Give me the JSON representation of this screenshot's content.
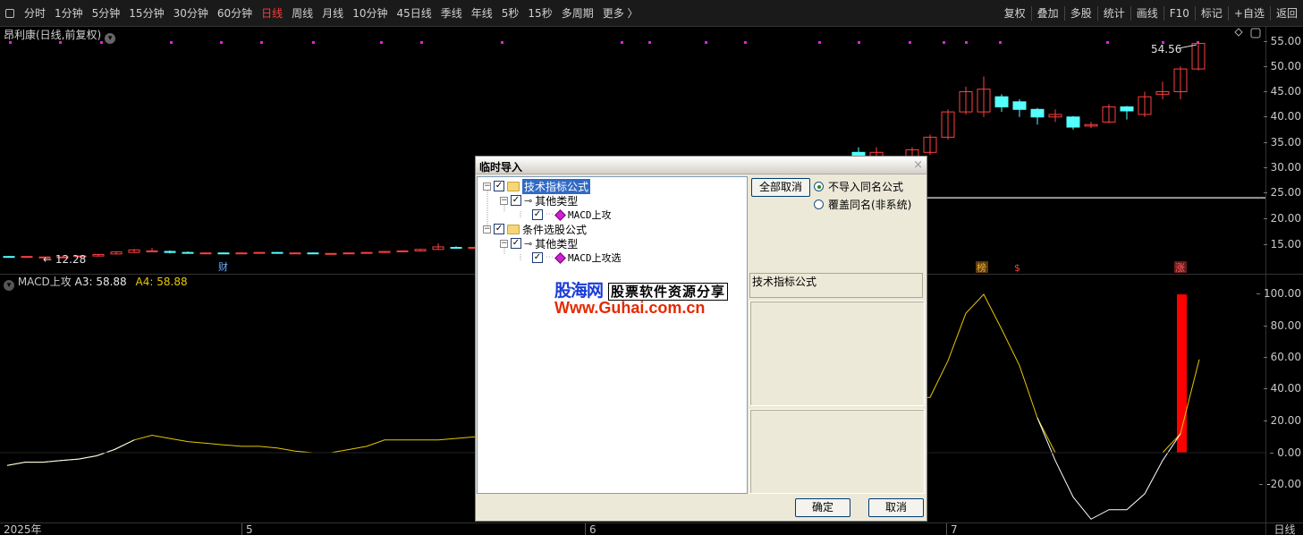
{
  "toolbar": {
    "left": [
      "分时",
      "1分钟",
      "5分钟",
      "15分钟",
      "30分钟",
      "60分钟",
      "日线",
      "周线",
      "月线",
      "10分钟",
      "45日线",
      "季线",
      "年线",
      "5秒",
      "15秒",
      "多周期",
      "更多 〉"
    ],
    "active": "日线",
    "right": [
      "复权",
      "叠加",
      "多股",
      "统计",
      "画线",
      "F10",
      "标记",
      "+自选",
      "返回"
    ]
  },
  "stock": {
    "title": "昂利康(日线,前复权)",
    "last_price_label": "54.56",
    "low_price_label": "← 12.28",
    "event_finance": "财",
    "event_list": "榜",
    "event_dollar": "$",
    "event_rise": "涨"
  },
  "price_axis": [
    "55.00",
    "50.00",
    "45.00",
    "40.00",
    "35.00",
    "30.00",
    "25.00",
    "20.00",
    "15.00"
  ],
  "indicator": {
    "name": "MACD上攻",
    "a3_label": "A3: 58.88",
    "a4_label": "A4: 58.88",
    "axis": [
      "100.00",
      "80.00",
      "60.00",
      "40.00",
      "20.00",
      "0.00",
      "-20.00"
    ]
  },
  "date_axis": {
    "labels": [
      "2025年",
      "5",
      "6",
      "7"
    ],
    "period": "日线"
  },
  "dialog": {
    "title": "临时导入",
    "close": "×",
    "tree": {
      "root1": "技术指标公式",
      "root1_child": "其他类型",
      "root1_leaf": "MACD上攻",
      "root2": "条件选股公式",
      "root2_child": "其他类型",
      "root2_leaf": "MACD上攻选"
    },
    "watermark_brand": "股海网",
    "watermark_slogan": "股票软件资源分享",
    "watermark_url": "Www.Guhai.com.cn",
    "btn_uncheck_all": "全部取消",
    "radio_skip": "不导入同名公式",
    "radio_overwrite": "覆盖同名(非系统)",
    "desc_label": "技术指标公式",
    "btn_ok": "确定",
    "btn_cancel": "取消"
  },
  "colors": {
    "up": "#ff4040",
    "down": "#54ffff",
    "a3_line": "#ffffff",
    "a4_line": "#e6c800",
    "marker": "#e020e0",
    "active": "#ff3b3b"
  },
  "chart_data": {
    "type": "line",
    "title": "MACD上攻",
    "xlabel": "",
    "ylabel": "",
    "ylim": [
      -20,
      100
    ],
    "series": [
      {
        "name": "A3",
        "values": [
          -8,
          -6,
          -6,
          -5,
          -4,
          -2,
          2,
          8,
          11,
          9,
          7,
          6,
          5,
          4,
          4,
          3,
          1,
          0,
          0,
          2,
          4,
          8,
          8,
          8,
          8,
          35,
          58,
          88,
          100,
          78,
          55,
          22,
          -5,
          -28,
          -42,
          -36,
          -36,
          -26,
          -5,
          12,
          58.88
        ]
      },
      {
        "name": "A4",
        "values": [
          -8,
          -6,
          -6,
          -5,
          -4,
          -2,
          2,
          8,
          11,
          9,
          7,
          6,
          5,
          4,
          4,
          3,
          1,
          0,
          0,
          2,
          4,
          8,
          8,
          8,
          8,
          35,
          58,
          88,
          100,
          78,
          55,
          22,
          0,
          0,
          0,
          0,
          0,
          0,
          0,
          12,
          58.88
        ]
      }
    ],
    "signal_bar": {
      "value": 100
    }
  }
}
